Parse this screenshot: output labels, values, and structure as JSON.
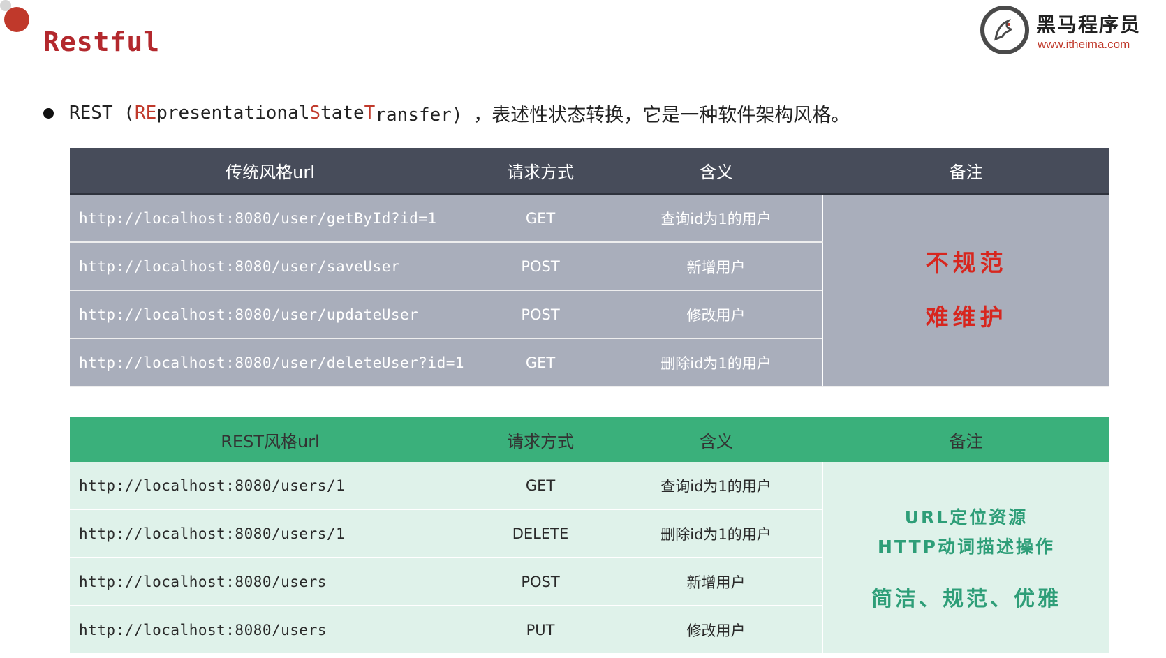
{
  "header": {
    "title": "Restful",
    "logo_name": "黑马程序员",
    "logo_url": "www.itheima.com"
  },
  "intro": {
    "p1": "REST (",
    "h1": "RE",
    "p2": "presentational ",
    "h2": "S",
    "p3": "tate ",
    "h3": "T",
    "p4": "ransfer) ，",
    "cn": "表述性状态转换，它是一种软件架构风格。"
  },
  "traditional_table": {
    "headers": [
      "传统风格url",
      "请求方式",
      "含义",
      "备注"
    ],
    "rows": [
      {
        "url": "http://localhost:8080/user/getById?id=1",
        "method": "GET",
        "meaning": "查询id为1的用户"
      },
      {
        "url": "http://localhost:8080/user/saveUser",
        "method": "POST",
        "meaning": "新增用户"
      },
      {
        "url": "http://localhost:8080/user/updateUser",
        "method": "POST",
        "meaning": "修改用户"
      },
      {
        "url": "http://localhost:8080/user/deleteUser?id=1",
        "method": "GET",
        "meaning": "删除id为1的用户"
      }
    ],
    "note_line1": "不规范",
    "note_line2": "难维护"
  },
  "rest_table": {
    "headers": [
      "REST风格url",
      "请求方式",
      "含义",
      "备注"
    ],
    "rows": [
      {
        "url": "http://localhost:8080/users/1",
        "method": "GET",
        "meaning": "查询id为1的用户"
      },
      {
        "url": "http://localhost:8080/users/1",
        "method": "DELETE",
        "meaning": "删除id为1的用户"
      },
      {
        "url": "http://localhost:8080/users",
        "method": "POST",
        "meaning": "新增用户"
      },
      {
        "url": "http://localhost:8080/users",
        "method": "PUT",
        "meaning": "修改用户"
      }
    ],
    "note_line1": "URL定位资源",
    "note_line2": "HTTP动词描述操作",
    "note_line3": "简洁、规范、优雅"
  },
  "colors": {
    "accent_red": "#b3282d",
    "header_dark": "#474c5a",
    "header_green": "#3ab07b",
    "note_red": "#d7261e",
    "note_green": "#2e9e78"
  }
}
